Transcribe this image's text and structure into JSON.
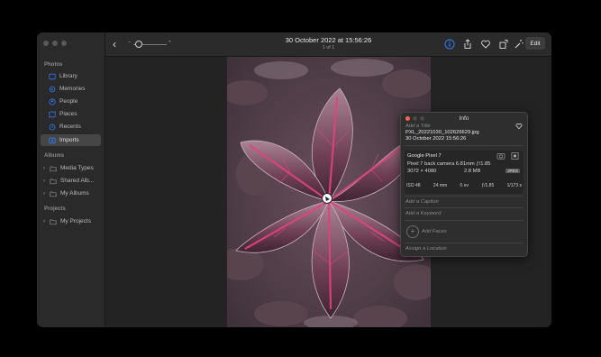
{
  "window": {
    "title": "30 October 2022 at 15:56:26",
    "subtitle": "1 of 1"
  },
  "toolbar": {
    "edit_label": "Edit",
    "icons": [
      "back-chevron-icon",
      "info-icon",
      "share-icon",
      "heart-icon",
      "rotate-icon",
      "magic-wand-icon"
    ]
  },
  "sidebar": {
    "sections": [
      {
        "title": "Photos",
        "items": [
          {
            "label": "Library"
          },
          {
            "label": "Memories"
          },
          {
            "label": "People"
          },
          {
            "label": "Places"
          },
          {
            "label": "Recents"
          },
          {
            "label": "Imports",
            "selected": true
          }
        ]
      },
      {
        "title": "Albums",
        "items": [
          {
            "label": "Media Types"
          },
          {
            "label": "Shared Alb..."
          },
          {
            "label": "My Albums"
          }
        ]
      },
      {
        "title": "Projects",
        "items": [
          {
            "label": "My Projects"
          }
        ]
      }
    ]
  },
  "info": {
    "panel_title": "Info",
    "title_placeholder": "Add a Title",
    "filename": "PXL_20221030_102626629.jpg",
    "datetime": "30 October 2022    15:56:26",
    "camera": "Google Pixel 7",
    "lens": "Pixel 7 back camera 6.81mm ƒ/1.85",
    "resolution": "3072 × 4080",
    "filesize": "2.8 MB",
    "format": "JPEG",
    "stats": {
      "iso": "ISO 48",
      "focal": "24 mm",
      "ev": "0 ev",
      "aperture": "ƒ/1.85",
      "shutter": "1/173 s"
    },
    "caption_placeholder": "Add a Caption",
    "keyword_placeholder": "Add a Keyword",
    "faces_label": "Add Faces",
    "location_placeholder": "Assign a Location"
  },
  "colors": {
    "accent": "#2f7bf6",
    "window_bg": "#1e1e1e",
    "sidebar_bg": "#2a2a2a"
  }
}
